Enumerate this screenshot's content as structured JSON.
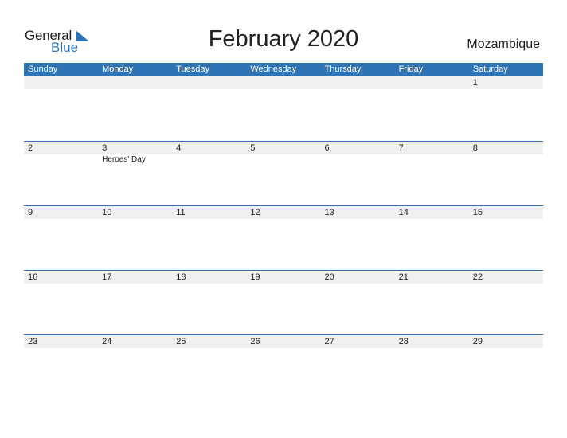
{
  "brand": {
    "line1": "General",
    "line2": "Blue",
    "accent": "#2e74b5"
  },
  "title": "February 2020",
  "country": "Mozambique",
  "weekdays": [
    "Sunday",
    "Monday",
    "Tuesday",
    "Wednesday",
    "Thursday",
    "Friday",
    "Saturday"
  ],
  "weeks": [
    {
      "days": [
        {
          "num": "",
          "holiday": ""
        },
        {
          "num": "",
          "holiday": ""
        },
        {
          "num": "",
          "holiday": ""
        },
        {
          "num": "",
          "holiday": ""
        },
        {
          "num": "",
          "holiday": ""
        },
        {
          "num": "",
          "holiday": ""
        },
        {
          "num": "1",
          "holiday": ""
        }
      ]
    },
    {
      "days": [
        {
          "num": "2",
          "holiday": ""
        },
        {
          "num": "3",
          "holiday": "Heroes' Day"
        },
        {
          "num": "4",
          "holiday": ""
        },
        {
          "num": "5",
          "holiday": ""
        },
        {
          "num": "6",
          "holiday": ""
        },
        {
          "num": "7",
          "holiday": ""
        },
        {
          "num": "8",
          "holiday": ""
        }
      ]
    },
    {
      "days": [
        {
          "num": "9",
          "holiday": ""
        },
        {
          "num": "10",
          "holiday": ""
        },
        {
          "num": "11",
          "holiday": ""
        },
        {
          "num": "12",
          "holiday": ""
        },
        {
          "num": "13",
          "holiday": ""
        },
        {
          "num": "14",
          "holiday": ""
        },
        {
          "num": "15",
          "holiday": ""
        }
      ]
    },
    {
      "days": [
        {
          "num": "16",
          "holiday": ""
        },
        {
          "num": "17",
          "holiday": ""
        },
        {
          "num": "18",
          "holiday": ""
        },
        {
          "num": "19",
          "holiday": ""
        },
        {
          "num": "20",
          "holiday": ""
        },
        {
          "num": "21",
          "holiday": ""
        },
        {
          "num": "22",
          "holiday": ""
        }
      ]
    },
    {
      "days": [
        {
          "num": "23",
          "holiday": ""
        },
        {
          "num": "24",
          "holiday": ""
        },
        {
          "num": "25",
          "holiday": ""
        },
        {
          "num": "26",
          "holiday": ""
        },
        {
          "num": "27",
          "holiday": ""
        },
        {
          "num": "28",
          "holiday": ""
        },
        {
          "num": "29",
          "holiday": ""
        }
      ]
    }
  ]
}
